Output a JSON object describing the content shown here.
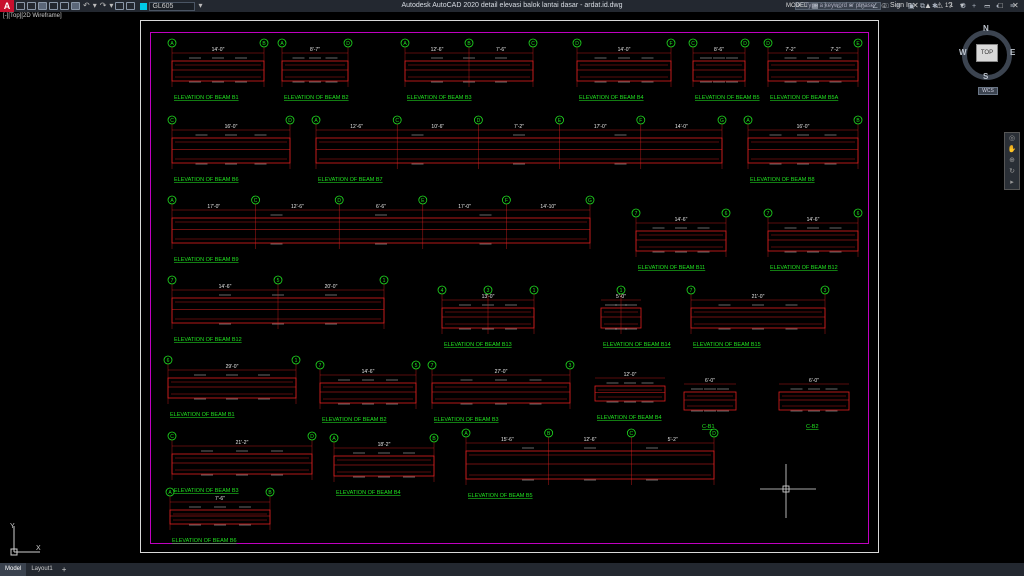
{
  "titlebar": {
    "logo": "A",
    "layer_name": "GL605",
    "title": "Autodesk AutoCAD 2020   detail elevasi balok lantai dasar - ardat.id.dwg",
    "search_placeholder": "Type a keyword or phrase",
    "sign_in": "Sign In"
  },
  "viewport": {
    "label": "[-][Top][2D Wireframe]"
  },
  "viewcube": {
    "top": "TOP",
    "north": "N",
    "south": "S",
    "west": "W",
    "east": "E",
    "wcs": "WCS"
  },
  "ucs": {
    "x": "X",
    "y": "Y"
  },
  "status": {
    "tabs": [
      "Model",
      "Layout1"
    ],
    "add": "+",
    "model_space": "MODEL",
    "scale": "1:1"
  },
  "drawing": {
    "elevations": [
      {
        "label": "ELEVATION OF BEAM B1",
        "bubbles": [
          "A",
          "B"
        ],
        "dims": [
          "14'-0\""
        ]
      },
      {
        "label": "ELEVATION OF BEAM B2",
        "bubbles": [
          "A",
          "D"
        ],
        "dims": [
          "8'-7\""
        ]
      },
      {
        "label": "ELEVATION OF BEAM B3",
        "bubbles": [
          "A",
          "B",
          "C"
        ],
        "dims": [
          "12'-6\"",
          "7'-6\""
        ]
      },
      {
        "label": "ELEVATION OF BEAM B4",
        "bubbles": [
          "D",
          "F"
        ],
        "dims": [
          "14'-0\""
        ]
      },
      {
        "label": "ELEVATION OF BEAM B5",
        "bubbles": [
          "C",
          "D"
        ],
        "dims": [
          "8'-6\""
        ]
      },
      {
        "label": "ELEVATION OF BEAM B5A",
        "bubbles": [
          "D",
          "E"
        ],
        "dims": [
          "7'-2\"",
          "7'-2\""
        ]
      },
      {
        "label": "ELEVATION OF BEAM B6",
        "bubbles": [
          "C",
          "D"
        ],
        "dims": [
          "16'-0\""
        ]
      },
      {
        "label": "ELEVATION OF BEAM B7",
        "bubbles": [
          "A",
          "C",
          "D",
          "E",
          "F",
          "G"
        ],
        "dims": [
          "12'-6\"",
          "10'-6\"",
          "7'-2\"",
          "17'-0\"",
          "14'-0\""
        ]
      },
      {
        "label": "ELEVATION OF BEAM B8",
        "bubbles": [
          "A",
          "B"
        ],
        "dims": [
          "16'-0\""
        ]
      },
      {
        "label": "ELEVATION OF BEAM B9",
        "bubbles": [
          "A",
          "C",
          "D",
          "E",
          "F",
          "G"
        ],
        "dims": [
          "17'-0\"",
          "12'-6\"",
          "6'-6\"",
          "17'-0\"",
          "14'-10\""
        ]
      },
      {
        "label": "ELEVATION OF BEAM B11",
        "bubbles": [
          "7",
          "6"
        ],
        "dims": [
          "14'-6\""
        ]
      },
      {
        "label": "ELEVATION OF BEAM B12",
        "bubbles": [
          "7",
          "6"
        ],
        "dims": [
          "14'-6\""
        ]
      },
      {
        "label": "ELEVATION OF BEAM B12",
        "bubbles": [
          "7",
          "5",
          "1"
        ],
        "dims": [
          "14'-6\"",
          "20'-0\""
        ]
      },
      {
        "label": "ELEVATION OF BEAM B13",
        "bubbles": [
          "4",
          "3",
          "1"
        ],
        "dims": [
          "13'-0\""
        ]
      },
      {
        "label": "ELEVATION OF BEAM B14",
        "bubbles": [
          "1"
        ],
        "dims": [
          "5'-0\""
        ]
      },
      {
        "label": "ELEVATION OF BEAM B15",
        "bubbles": [
          "7",
          "3"
        ],
        "dims": [
          "21'-0\""
        ]
      },
      {
        "label": "ELEVATION OF BEAM B1",
        "bubbles": [
          "6",
          "1"
        ],
        "dims": [
          "29'-0\""
        ]
      },
      {
        "label": "ELEVATION OF BEAM B2",
        "bubbles": [
          "7",
          "5"
        ],
        "dims": [
          "14'-6\""
        ]
      },
      {
        "label": "ELEVATION OF BEAM B3",
        "bubbles": [
          "7",
          "3"
        ],
        "dims": [
          "27'-0\""
        ]
      },
      {
        "label": "ELEVATION OF BEAM B4",
        "bubbles": [],
        "dims": [
          "12'-0\""
        ]
      },
      {
        "label": "C-B1",
        "bubbles": [],
        "dims": [
          "6'-0\""
        ]
      },
      {
        "label": "C-B2",
        "bubbles": [],
        "dims": [
          "6'-0\""
        ]
      },
      {
        "label": "ELEVATION OF BEAM B3",
        "bubbles": [
          "C",
          "D"
        ],
        "dims": [
          "21'-2\""
        ]
      },
      {
        "label": "ELEVATION OF BEAM B4",
        "bubbles": [
          "A",
          "B"
        ],
        "dims": [
          "18'-2\""
        ]
      },
      {
        "label": "ELEVATION OF BEAM B5",
        "bubbles": [
          "A",
          "B",
          "C",
          "D"
        ],
        "dims": [
          "15'-6\"",
          "12'-6\"",
          "5'-2\""
        ]
      },
      {
        "label": "ELEVATION OF BEAM B6",
        "bubbles": [
          "A",
          "B"
        ],
        "dims": [
          "7'-6\""
        ]
      }
    ]
  }
}
